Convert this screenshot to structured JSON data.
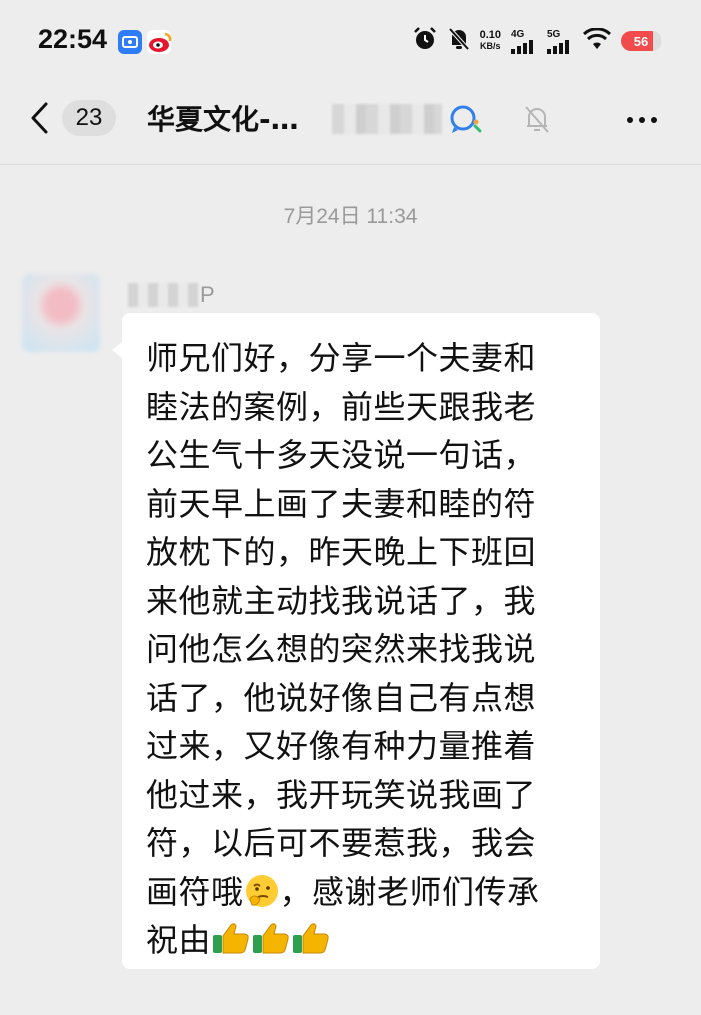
{
  "status_bar": {
    "time": "22:54",
    "net_speed_value": "0.10",
    "net_speed_unit": "KB/s",
    "signal_1": "4G",
    "signal_2": "5G",
    "battery": "56",
    "icons": [
      "alarm-icon",
      "mute-bell-icon",
      "signal-bars-icon",
      "wifi-icon",
      "battery-icon"
    ]
  },
  "nav": {
    "unread_count": "23",
    "title": "华夏文化-…",
    "icons": [
      "back-chevron-icon",
      "search-icon",
      "mute-bell-icon",
      "more-icon"
    ]
  },
  "chat": {
    "timestamp": "7月24日 11:34",
    "sender_suffix": "P",
    "message_lines": [
      "师兄们好，分享一个夫妻和",
      "睦法的案例，前些天跟我老",
      "公生气十多天没说一句话，",
      "前天早上画了夫妻和睦的符",
      "放枕下的，昨天晚上下班回",
      "来他就主动找我说话了，我",
      "问他怎么想的突然来找我说",
      "话了，他说好像自己有点想",
      "过来，又好像有种力量推着",
      "他过来，我开玩笑说我画了",
      "符，以后可不要惹我，我会",
      "画符哦",
      "，感谢老师们传承",
      "祝由"
    ]
  },
  "colors": {
    "background": "#ededed",
    "bubble": "#ffffff",
    "battery": "#f14b4b",
    "meta_text": "#999999"
  }
}
